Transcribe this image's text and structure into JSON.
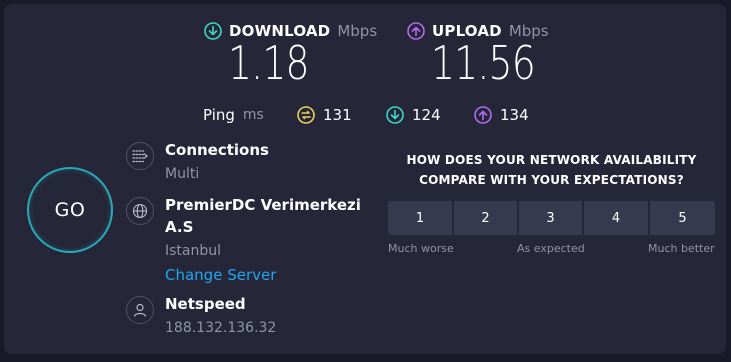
{
  "download": {
    "label": "DOWNLOAD",
    "unit": "Mbps",
    "value": "1.18"
  },
  "upload": {
    "label": "UPLOAD",
    "unit": "Mbps",
    "value": "11.56"
  },
  "ping": {
    "label": "Ping",
    "unit": "ms",
    "idle": "131",
    "down": "124",
    "up": "134"
  },
  "go_label": "GO",
  "connections": {
    "label": "Connections",
    "value": "Multi"
  },
  "server": {
    "name_line1": "PremierDC Verimerkezi",
    "name_line2": "A.S",
    "location": "Istanbul",
    "change": "Change Server"
  },
  "provider": {
    "name": "Netspeed",
    "ip": "188.132.136.32"
  },
  "survey": {
    "question_line1": "HOW DOES YOUR NETWORK AVAILABILITY",
    "question_line2": "COMPARE WITH YOUR EXPECTATIONS?",
    "ratings": [
      "1",
      "2",
      "3",
      "4",
      "5"
    ],
    "low": "Much worse",
    "mid": "As expected",
    "high": "Much better"
  },
  "colors": {
    "download": "#3ed6c8",
    "upload": "#b36cf0",
    "ping": "#ecd25a",
    "go_ring": "#2aa8b8",
    "link": "#1fa6f0"
  },
  "icons": [
    "download-arrow-icon",
    "upload-arrow-icon",
    "ping-icon",
    "connections-icon",
    "globe-icon",
    "person-icon"
  ]
}
